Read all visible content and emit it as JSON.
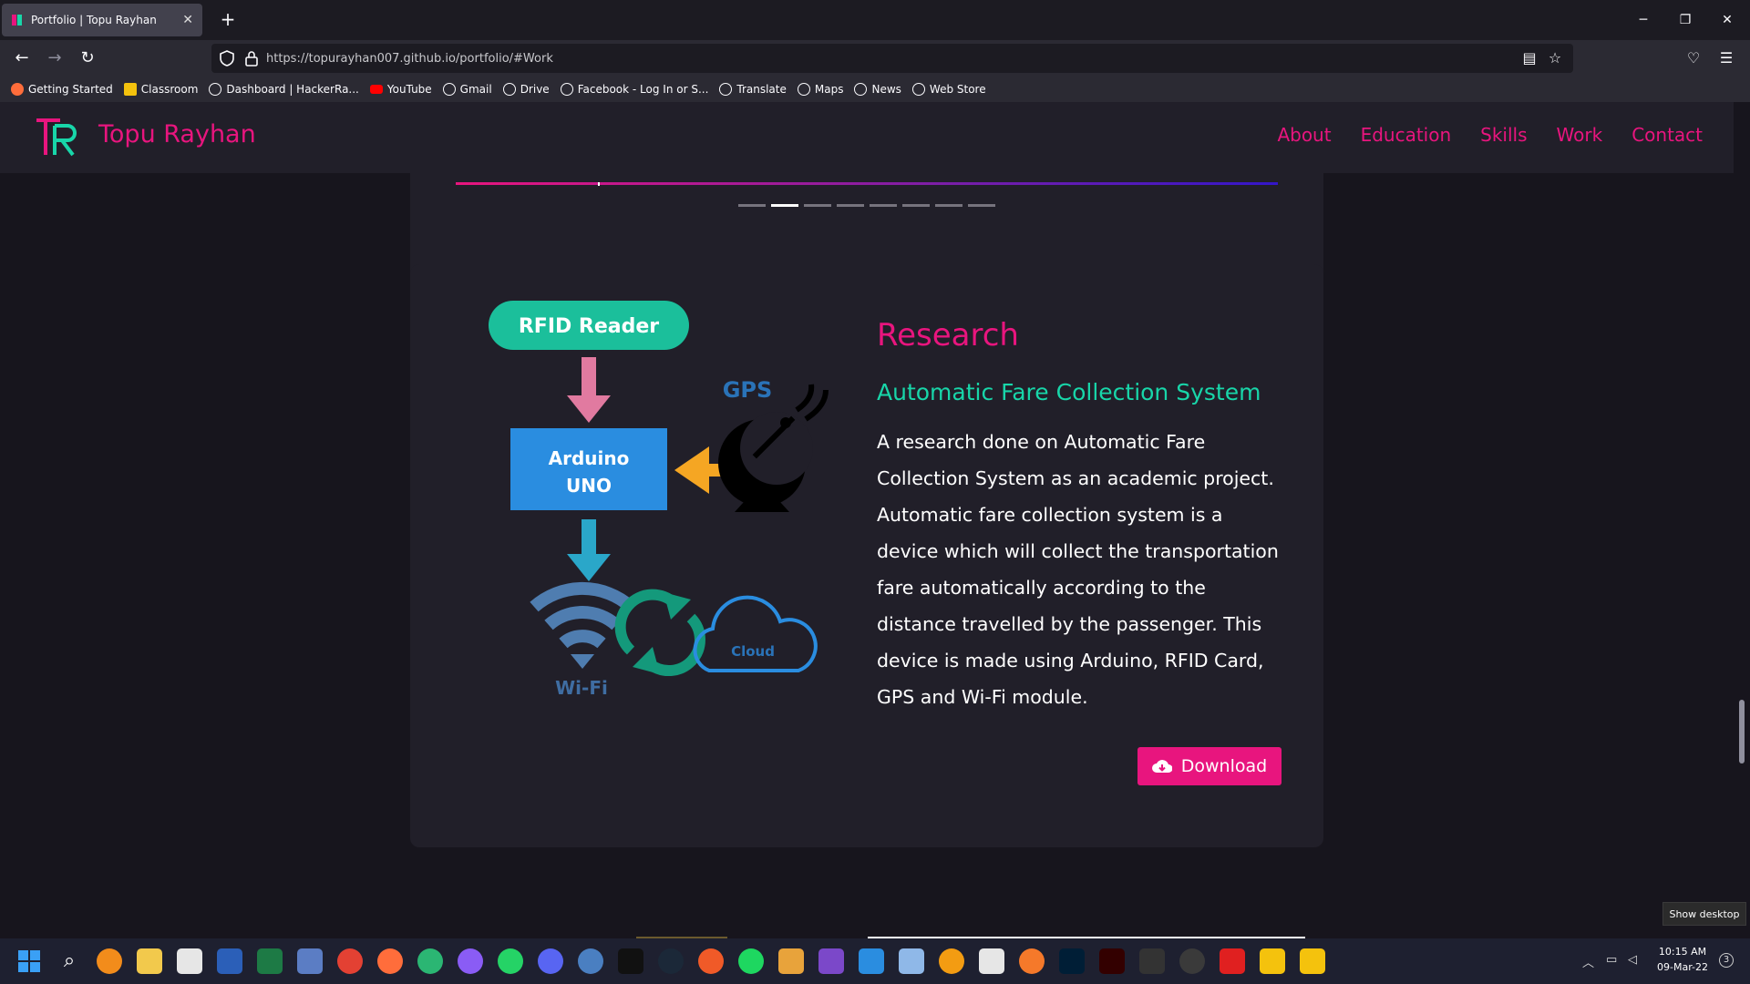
{
  "browser": {
    "tab_title": "Portfolio | Topu Rayhan",
    "url": "https://topurayhan007.github.io/portfolio/#Work",
    "bookmarks": [
      {
        "label": "Getting Started",
        "icon": "firefox-icon"
      },
      {
        "label": "Classroom",
        "icon": "classroom-icon"
      },
      {
        "label": "Dashboard | HackerRa...",
        "icon": "globe-icon"
      },
      {
        "label": "YouTube",
        "icon": "youtube-icon"
      },
      {
        "label": "Gmail",
        "icon": "globe-icon"
      },
      {
        "label": "Drive",
        "icon": "globe-icon"
      },
      {
        "label": "Facebook - Log In or S...",
        "icon": "globe-icon"
      },
      {
        "label": "Translate",
        "icon": "globe-icon"
      },
      {
        "label": "Maps",
        "icon": "globe-icon"
      },
      {
        "label": "News",
        "icon": "globe-icon"
      },
      {
        "label": "Web Store",
        "icon": "globe-icon"
      }
    ]
  },
  "site": {
    "brand": "Topu Rayhan",
    "nav": [
      "About",
      "Education",
      "Skills",
      "Work",
      "Contact"
    ],
    "accent_color": "#e8157e",
    "teal_color": "#18d6a9"
  },
  "carousel": {
    "dot_count": 8,
    "active_index": 1
  },
  "work_item": {
    "category": "Research",
    "project_title": "Automatic Fare Collection System",
    "description": "A research done on Automatic Fare Collection System as an academic project. Automatic fare collection system is a device which will collect the transportation fare automatically according to the distance travelled by the passenger. This device is made using Arduino, RFID Card, GPS and Wi-Fi module.",
    "download_label": "Download",
    "diagram": {
      "rfid": "RFID Reader",
      "arduino_line1": "Arduino",
      "arduino_line2": "UNO",
      "gps": "GPS",
      "wifi": "Wi-Fi",
      "cloud": "Cloud"
    }
  },
  "tooltip": "Show desktop",
  "clock": {
    "time": "10:15 AM",
    "date": "09-Mar-22",
    "notifications": "3"
  }
}
